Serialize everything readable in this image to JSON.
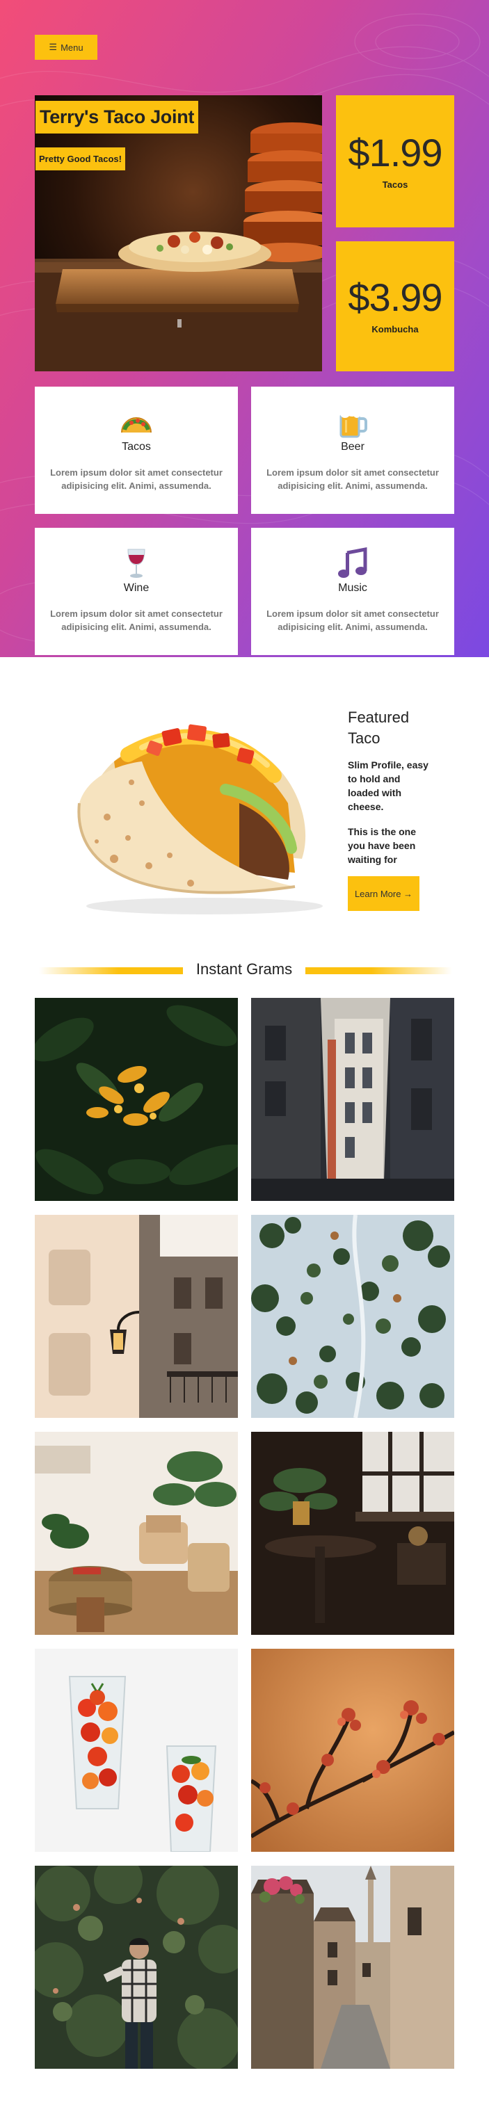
{
  "menu": {
    "label": "Menu",
    "icon": "hamburger-icon"
  },
  "hero": {
    "title": "Terry's Taco Joint",
    "subtitle": "Pretty Good Tacos!"
  },
  "prices": [
    {
      "value": "$1.99",
      "label": "Tacos"
    },
    {
      "value": "$3.99",
      "label": "Kombucha"
    }
  ],
  "features": [
    {
      "title": "Tacos",
      "icon": "taco-icon",
      "text": "Lorem ipsum dolor sit amet consectetur adipisicing elit. Animi, assumenda."
    },
    {
      "title": "Beer",
      "icon": "beer-mug-icon",
      "text": "Lorem ipsum dolor sit amet consectetur adipisicing elit. Animi, assumenda."
    },
    {
      "title": "Wine",
      "icon": "wine-glass-icon",
      "text": "Lorem ipsum dolor sit amet consectetur adipisicing elit. Animi, assumenda."
    },
    {
      "title": "Music",
      "icon": "music-notes-icon",
      "text": "Lorem ipsum dolor sit amet consectetur adipisicing elit. Animi, assumenda."
    }
  ],
  "featured": {
    "title": "Featured Taco",
    "description": "Slim Profile, easy to hold and loaded with cheese.",
    "description2": "This is the one you have been waiting for",
    "button_label": "Learn More →"
  },
  "grams": {
    "title": "Instant Grams",
    "photos": [
      "orange-flowers-photo",
      "alley-buildings-photo",
      "street-lamp-building-photo",
      "snowy-forest-aerial-photo",
      "living-room-chairs-photo",
      "dark-room-plant-photo",
      "tomato-glasses-photo",
      "blossom-branch-photo",
      "man-in-garden-photo",
      "old-town-street-photo"
    ]
  },
  "colors": {
    "accent": "#fcc10f",
    "gradient_start": "#f24d78",
    "gradient_end": "#7b49e2"
  }
}
